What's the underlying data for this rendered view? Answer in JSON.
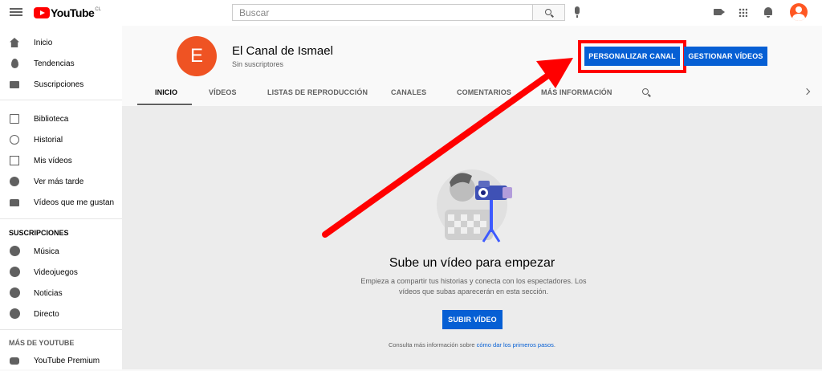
{
  "topbar": {
    "logo_text": "YouTube",
    "logo_country": "CL",
    "search_placeholder": "Buscar"
  },
  "sidebar": {
    "main_items": [
      {
        "label": "Inicio",
        "icon": "home-icon"
      },
      {
        "label": "Tendencias",
        "icon": "trending-icon"
      },
      {
        "label": "Suscripciones",
        "icon": "subscriptions-icon"
      }
    ],
    "library_items": [
      {
        "label": "Biblioteca",
        "icon": "library-icon"
      },
      {
        "label": "Historial",
        "icon": "history-icon"
      },
      {
        "label": "Mis vídeos",
        "icon": "my-videos-icon"
      },
      {
        "label": "Ver más tarde",
        "icon": "watch-later-icon"
      },
      {
        "label": "Vídeos que me gustan",
        "icon": "liked-icon"
      }
    ],
    "subscriptions_heading": "SUSCRIPCIONES",
    "subscription_items": [
      {
        "label": "Música",
        "icon": "music-icon"
      },
      {
        "label": "Videojuegos",
        "icon": "gaming-icon"
      },
      {
        "label": "Noticias",
        "icon": "news-icon"
      },
      {
        "label": "Directo",
        "icon": "live-icon"
      }
    ],
    "more_heading": "MÁS DE YOUTUBE",
    "more_items": [
      {
        "label": "YouTube Premium",
        "icon": "youtube-premium-icon"
      }
    ]
  },
  "channel": {
    "avatar_letter": "E",
    "name": "El Canal de Ismael",
    "subscribers": "Sin suscriptores",
    "customize_label": "PERSONALIZAR CANAL",
    "manage_label": "GESTIONAR VÍDEOS",
    "accent_color": "#065fd4"
  },
  "tabs": [
    {
      "label": "INICIO",
      "active": true
    },
    {
      "label": "VÍDEOS"
    },
    {
      "label": "LISTAS DE REPRODUCCIÓN"
    },
    {
      "label": "CANALES"
    },
    {
      "label": "COMENTARIOS"
    },
    {
      "label": "MÁS INFORMACIÓN"
    }
  ],
  "empty_state": {
    "title": "Sube un vídeo para empezar",
    "description": "Empieza a compartir tus historias y conecta con los espectadores. Los vídeos que subas aparecerán en esta sección.",
    "upload_label": "SUBIR VÍDEO",
    "help_prefix": "Consulta más información sobre",
    "help_link": "cómo dar los primeros pasos",
    "help_suffix": "."
  },
  "annotation": {
    "color": "#ff0000"
  }
}
